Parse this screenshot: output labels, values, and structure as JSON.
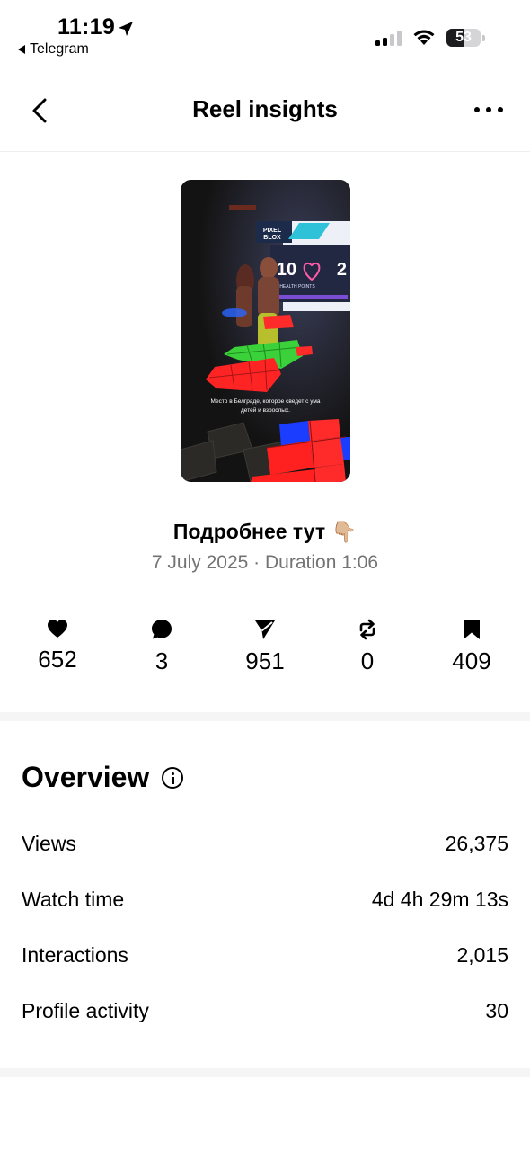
{
  "status_bar": {
    "time": "11:19",
    "back_app": "Telegram",
    "battery": "53",
    "battery_level": 0.53
  },
  "nav": {
    "title": "Reel insights"
  },
  "reel": {
    "caption_overlay": "Место в Белграде, которое сведет с ума детей и взрослых.",
    "sign_text": "PIXEL BLOX",
    "health_value": "10",
    "health_label": "HEALTH POINTS",
    "title": "Подробнее тут 👇🏼",
    "meta": "7 July 2025 · Duration 1:06"
  },
  "stats": [
    {
      "icon": "heart-icon",
      "value": "652"
    },
    {
      "icon": "comment-icon",
      "value": "3"
    },
    {
      "icon": "share-icon",
      "value": "951"
    },
    {
      "icon": "repost-icon",
      "value": "0"
    },
    {
      "icon": "save-icon",
      "value": "409"
    }
  ],
  "overview": {
    "title": "Overview",
    "rows": [
      {
        "label": "Views",
        "value": "26,375"
      },
      {
        "label": "Watch time",
        "value": "4d 4h 29m 13s"
      },
      {
        "label": "Interactions",
        "value": "2,015"
      },
      {
        "label": "Profile activity",
        "value": "30"
      }
    ]
  }
}
